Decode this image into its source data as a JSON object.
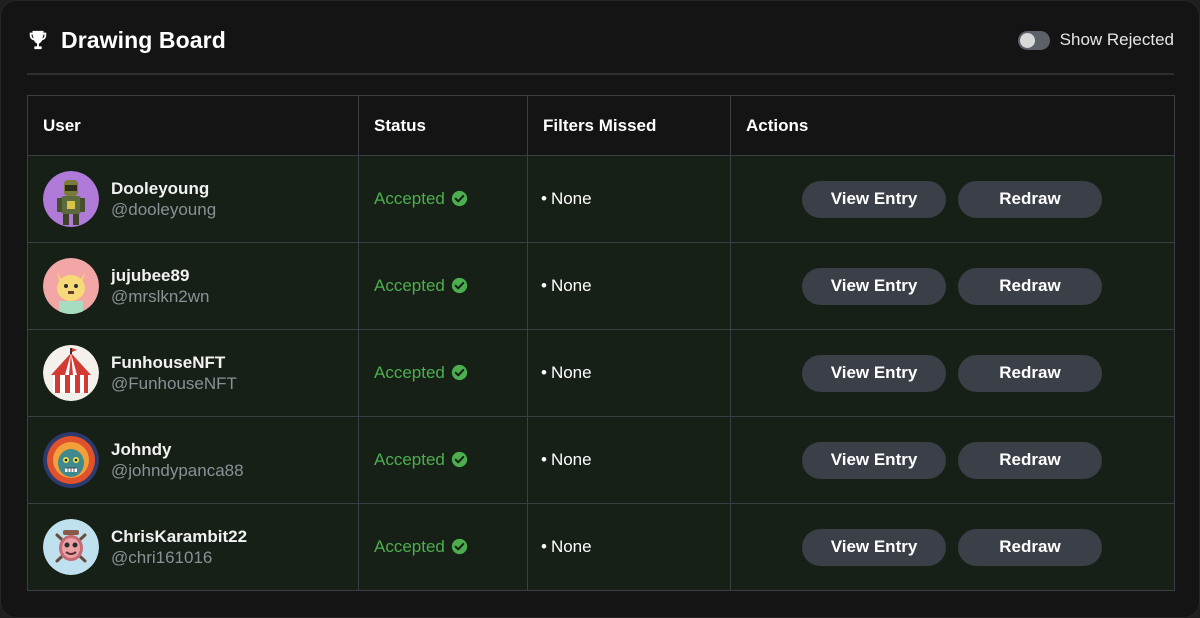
{
  "header": {
    "title": "Drawing Board",
    "toggle_label": "Show Rejected",
    "toggle_on": false
  },
  "columns": [
    "User",
    "Status",
    "Filters Missed",
    "Actions"
  ],
  "rows": [
    {
      "name": "Dooleyoung",
      "handle": "@dooleyoung",
      "status": "Accepted",
      "filters": "None",
      "view_label": "View Entry",
      "redraw_label": "Redraw"
    },
    {
      "name": "jujubee89",
      "handle": "@mrslkn2wn",
      "status": "Accepted",
      "filters": "None",
      "view_label": "View Entry",
      "redraw_label": "Redraw"
    },
    {
      "name": "FunhouseNFT",
      "handle": "@FunhouseNFT",
      "status": "Accepted",
      "filters": "None",
      "view_label": "View Entry",
      "redraw_label": "Redraw"
    },
    {
      "name": "Johndy",
      "handle": "@johndypanca88",
      "status": "Accepted",
      "filters": "None",
      "view_label": "View Entry",
      "redraw_label": "Redraw"
    },
    {
      "name": "ChrisKarambit22",
      "handle": "@chri161016",
      "status": "Accepted",
      "filters": "None",
      "view_label": "View Entry",
      "redraw_label": "Redraw"
    }
  ],
  "icons": {
    "title": "trophy-icon",
    "status": "check-circle-icon"
  },
  "colors": {
    "accepted": "#4cae4f",
    "button_bg": "#3a3f48",
    "row_bg": "#172017"
  }
}
